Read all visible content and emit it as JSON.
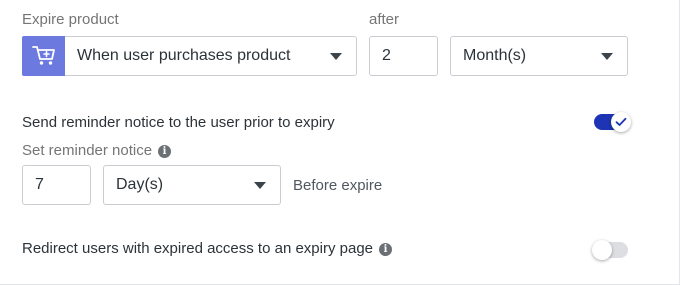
{
  "expire": {
    "label": "Expire product",
    "after_label": "after",
    "condition_value": "When user purchases product",
    "amount_value": "2",
    "unit_value": "Month(s)"
  },
  "reminder": {
    "toggle_label": "Send reminder notice to the user prior to expiry",
    "toggle_on": true,
    "set_label": "Set reminder notice",
    "amount_value": "7",
    "unit_value": "Day(s)",
    "suffix": "Before expire"
  },
  "redirect": {
    "label": "Redirect users with expired access to an expiry page",
    "toggle_on": false
  },
  "colors": {
    "accent": "#1d35b4",
    "cart_bg": "#6c7ae0"
  },
  "icons": {
    "cart": "cart-icon",
    "info": "info-icon"
  }
}
